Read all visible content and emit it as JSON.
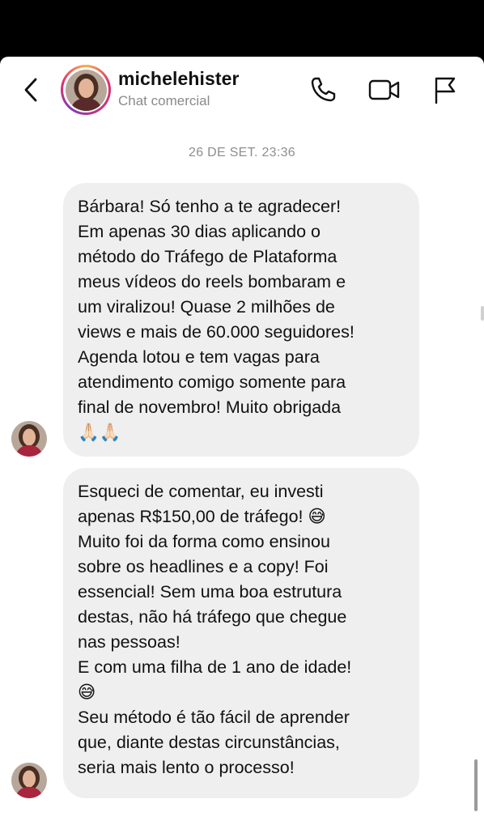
{
  "header": {
    "username": "michelehister",
    "subtitle": "Chat comercial",
    "icons": [
      "back-chevron-icon",
      "phone-icon",
      "video-call-icon",
      "flag-icon"
    ]
  },
  "conversation": {
    "timestamp": "26 DE SET. 23:36",
    "messages": [
      {
        "text": "Bárbara! Só tenho a te agradecer!\nEm apenas 30 dias aplicando o\nmétodo do Tráfego de Plataforma\nmeus vídeos do reels bombaram e\num viralizou! Quase 2 milhões de\nviews e mais de 60.000 seguidores!\nAgenda lotou e tem vagas para\natendimento comigo somente para\nfinal de novembro! Muito obrigada\n🙏🏻🙏🏻"
      },
      {
        "text": "Esqueci de comentar, eu investi\napenas R$150,00 de tráfego! 😅\nMuito foi da forma como ensinou\nsobre os headlines e a copy! Foi\nessencial! Sem uma boa estrutura\ndestas, não há tráfego que chegue\nnas pessoas!\nE com uma filha de 1 ano de idade!\n😅\nSeu método é tão fácil de aprender\nque, diante destas circunstâncias,\nseria mais lento o processo!"
      }
    ]
  },
  "colors": {
    "bubble_bg": "#efefef",
    "header_text": "#111111",
    "subtitle_text": "#8a8a8a",
    "timestamp_text": "#8e8e8e"
  }
}
